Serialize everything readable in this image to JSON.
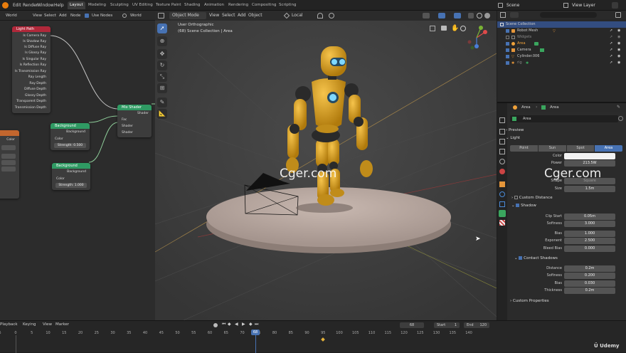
{
  "topbar": {
    "menus": [
      "Edit",
      "Render",
      "Window",
      "Help"
    ],
    "workspaces": [
      "Layout",
      "Modeling",
      "Sculpting",
      "UV Editing",
      "Texture Paint",
      "Shading",
      "Animation",
      "Rendering",
      "Compositing",
      "Scripting"
    ],
    "scene": "Scene",
    "view_layer": "View Layer"
  },
  "node_editor": {
    "header": {
      "world": "World",
      "view": "View",
      "select": "Select",
      "add": "Add",
      "node": "Node",
      "use_nodes": "Use Nodes",
      "world2": "World"
    },
    "light_path": {
      "title": "Light Path",
      "outputs": [
        "Is Camera Ray",
        "Is Shadow Ray",
        "Is Diffuse Ray",
        "Is Glossy Ray",
        "Is Singular Ray",
        "Is Reflection Ray",
        "Is Transmission Ray",
        "Ray Length",
        "Ray Depth",
        "Diffuse Depth",
        "Glossy Depth",
        "Transparent Depth",
        "Transmission Depth"
      ]
    },
    "mix_shader": {
      "title": "Mix Shader",
      "output": "Shader",
      "inputs": [
        "Fac",
        "Shader",
        "Shader"
      ]
    },
    "background1": {
      "title": "Background",
      "output": "Background",
      "color": "Color",
      "strength": "Strength: 0.500"
    },
    "background2": {
      "title": "Background",
      "output": "Background",
      "color": "Color",
      "strength": "Strength: 1.000"
    },
    "partial_color": "Color"
  },
  "viewport": {
    "header": {
      "mode": "Object Mode",
      "view": "View",
      "select": "Select",
      "add": "Add",
      "object": "Object",
      "orientation": "Local"
    },
    "overlay_title": "User Orthographic",
    "overlay_sub": "(68) Scene Collection | Area",
    "watermark": "Cger.com"
  },
  "outliner": {
    "search_placeholder": "",
    "items": [
      {
        "label": "Scene Collection",
        "level": 0,
        "selected": true
      },
      {
        "label": "Robot Mesh",
        "level": 1
      },
      {
        "label": "Widgets",
        "level": 1
      },
      {
        "label": "Area",
        "level": 1,
        "active": true
      },
      {
        "label": "Camera",
        "level": 1
      },
      {
        "label": "Cylinder.006",
        "level": 1
      },
      {
        "label": "rig",
        "level": 1
      }
    ]
  },
  "properties": {
    "breadcrumb_obj": "Area",
    "breadcrumb_data": "Area",
    "data_name": "Area",
    "sections": {
      "preview": "Preview",
      "light": "Light",
      "custom_distance": "Custom Distance",
      "shadow": "Shadow",
      "contact_shadows": "Contact Shadows",
      "custom_properties": "Custom Properties"
    },
    "light_types": [
      "Point",
      "Sun",
      "Spot",
      "Area"
    ],
    "active_light_type": "Area",
    "light_fields": [
      {
        "label": "Color",
        "value": ""
      },
      {
        "label": "Power",
        "value": "213.5W"
      },
      {
        "label": "Shape",
        "value": "Square"
      },
      {
        "label": "Size",
        "value": "1.5m"
      }
    ],
    "shadow_fields": [
      {
        "label": "Clip Start",
        "value": "0.05m"
      },
      {
        "label": "Softness",
        "value": "3.000"
      },
      {
        "label": "Bias",
        "value": "1.000"
      },
      {
        "label": "Exponent",
        "value": "2.500"
      },
      {
        "label": "Bleed Bias",
        "value": "0.000"
      }
    ],
    "contact_fields": [
      {
        "label": "Distance",
        "value": "0.2m"
      },
      {
        "label": "Softness",
        "value": "0.200"
      },
      {
        "label": "Bias",
        "value": "0.030"
      },
      {
        "label": "Thickness",
        "value": "0.2m"
      }
    ],
    "watermark": "Cger.com"
  },
  "timeline": {
    "header": {
      "playback": "Playback",
      "keying": "Keying",
      "view": "View",
      "marker": "Marker"
    },
    "current_frame": "68",
    "start_label": "Start",
    "start": "1",
    "end_label": "End",
    "end": "120",
    "ticks": [
      "-5",
      "0",
      "5",
      "10",
      "15",
      "20",
      "25",
      "30",
      "35",
      "40",
      "45",
      "50",
      "55",
      "60",
      "65",
      "70",
      "75",
      "80",
      "85",
      "90",
      "95",
      "100",
      "105",
      "110",
      "115",
      "120",
      "125",
      "130",
      "135",
      "140"
    ],
    "brand": "Udemy"
  },
  "colors": {
    "accent": "#4772b3",
    "light_path_head": "#b0283a",
    "shader_head": "#2f9a63",
    "robot_yellow": "#d9a21a",
    "eye_blue": "#7fd8ff"
  }
}
